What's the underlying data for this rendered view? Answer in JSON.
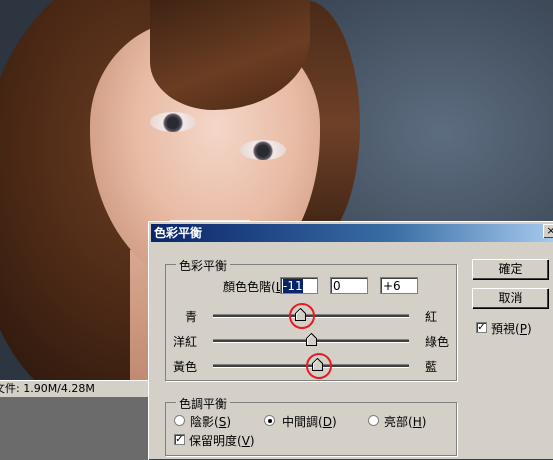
{
  "status_bar": {
    "text": "文件: 1.90M/4.28M"
  },
  "dialog": {
    "title": "色彩平衡",
    "close_label": "×",
    "balance_group": {
      "legend": "色彩平衡",
      "levels_label": "顏色色階(L):",
      "levels": [
        "-11",
        "0",
        "+6"
      ],
      "sliders": [
        {
          "left": "青",
          "right": "紅",
          "value": -11,
          "highlighted": true
        },
        {
          "left": "洋紅",
          "right": "綠色",
          "value": 0,
          "highlighted": false
        },
        {
          "left": "黃色",
          "right": "藍",
          "value": 6,
          "highlighted": true
        }
      ],
      "slider_range": [
        -100,
        100
      ]
    },
    "tone_group": {
      "legend": "色調平衡",
      "shadows": "陰影(S)",
      "midtones": "中間調(D)",
      "highlights": "亮部(H)",
      "selected": "midtones",
      "preserve_luminosity": "保留明度(V)",
      "preserve_checked": true
    },
    "ok_label": "確定",
    "cancel_label": "取消",
    "preview_label": "預視(P)",
    "preview_checked": true,
    "highlight_color": "#e51c23"
  }
}
